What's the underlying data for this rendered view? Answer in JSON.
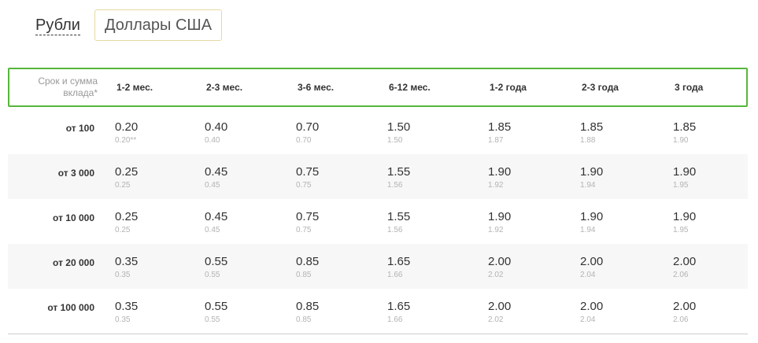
{
  "currency_tabs": {
    "rub_label": "Рубли",
    "usd_label": "Доллары США"
  },
  "table": {
    "corner_label": "Срок и сумма вклада*",
    "columns": [
      "1-2 мес.",
      "2-3 мес.",
      "3-6 мес.",
      "6-12 мес.",
      "1-2 года",
      "2-3 года",
      "3 года"
    ],
    "rows": [
      {
        "label": "от 100",
        "rates": [
          "0.20",
          "0.40",
          "0.70",
          "1.50",
          "1.85",
          "1.85",
          "1.85"
        ],
        "subrates": [
          "0.20**",
          "0.40",
          "0.70",
          "1.50",
          "1.87",
          "1.88",
          "1.90"
        ]
      },
      {
        "label": "от 3 000",
        "rates": [
          "0.25",
          "0.45",
          "0.75",
          "1.55",
          "1.90",
          "1.90",
          "1.90"
        ],
        "subrates": [
          "0.25",
          "0.45",
          "0.75",
          "1.56",
          "1.92",
          "1.94",
          "1.95"
        ]
      },
      {
        "label": "от 10 000",
        "rates": [
          "0.25",
          "0.45",
          "0.75",
          "1.55",
          "1.90",
          "1.90",
          "1.90"
        ],
        "subrates": [
          "0.25",
          "0.45",
          "0.75",
          "1.56",
          "1.92",
          "1.94",
          "1.95"
        ]
      },
      {
        "label": "от 20 000",
        "rates": [
          "0.35",
          "0.55",
          "0.85",
          "1.65",
          "2.00",
          "2.00",
          "2.00"
        ],
        "subrates": [
          "0.35",
          "0.55",
          "0.85",
          "1.66",
          "2.02",
          "2.04",
          "2.06"
        ]
      },
      {
        "label": "от 100 000",
        "rates": [
          "0.35",
          "0.55",
          "0.85",
          "1.65",
          "2.00",
          "2.00",
          "2.00"
        ],
        "subrates": [
          "0.35",
          "0.55",
          "0.85",
          "1.66",
          "2.02",
          "2.04",
          "2.06"
        ]
      }
    ]
  },
  "colors": {
    "header_border": "#56b63b",
    "active_tab_border": "#e6d9a0",
    "alt_row_bg": "#f7f7f7",
    "subrate_text": "#b3b3b3"
  }
}
